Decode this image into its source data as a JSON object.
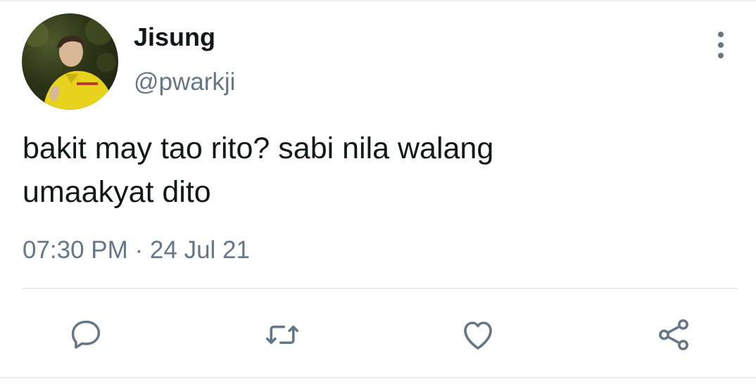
{
  "tweet": {
    "author": {
      "display_name": "Jisung",
      "handle": "@pwarkji"
    },
    "text_lines": [
      "bakit may tao rito? sabi nila walang",
      "umaakyat dito"
    ],
    "timestamp": "07:30 PM · 24 Jul 21"
  },
  "actions": [
    {
      "icon": "reply-icon"
    },
    {
      "icon": "retweet-icon"
    },
    {
      "icon": "like-icon"
    },
    {
      "icon": "share-icon"
    }
  ],
  "colors": {
    "text_primary": "#14171a",
    "text_secondary": "#657786",
    "icon": "#657786",
    "divider": "#e6ecf0"
  }
}
